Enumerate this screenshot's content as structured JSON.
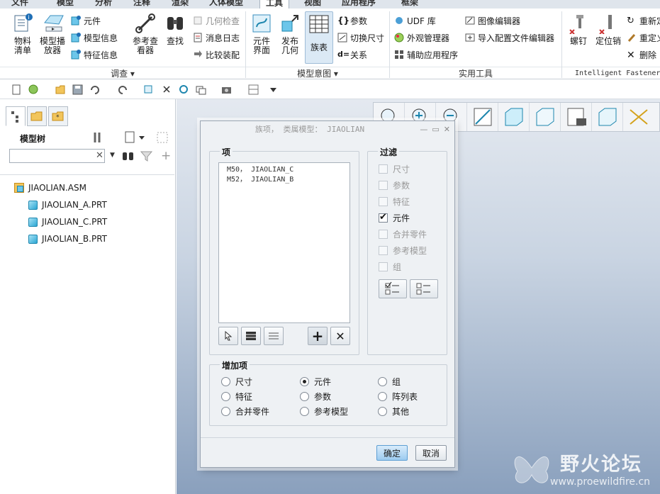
{
  "ribbon_tabs": [
    "文件",
    "模型",
    "分析",
    "注释",
    "渲染",
    "工具",
    "视图",
    "人体模型",
    "应用程序",
    "框架"
  ],
  "active_tab": "工具",
  "ribbon": {
    "investigate": {
      "label": "调查",
      "bom": "物料\n清单",
      "model_player": "模型播\n放器",
      "component": "元件",
      "model_info": "模型信息",
      "feature_info": "特征信息",
      "ref_viewer": "参考查\n看器",
      "find": "查找",
      "geometry_check": "几何检查",
      "message_log": "消息日志",
      "compare_asm": "比较装配"
    },
    "model_intent": {
      "label": "模型意图",
      "component_interface": "元件\n界面",
      "publish_geom": "发布\n几何",
      "family_table": "族表",
      "parameters": "参数",
      "switch_dims": "切换尺寸",
      "relations": "关系"
    },
    "utilities": {
      "label": "实用工具",
      "udf_lib": "UDF 库",
      "appearance_mgr": "外观管理器",
      "aux_apps": "辅助应用程序",
      "image_editor": "图像编辑器",
      "import_config": "导入配置文件编辑器"
    },
    "fastener": {
      "label": "Intelligent Fastener",
      "screw": "螺钉",
      "locating_pin": "定位销",
      "redefine": "重新定",
      "reuse": "重定义",
      "delete": "删除"
    }
  },
  "model_tree": {
    "title": "模型树",
    "search_placeholder": "",
    "root": "JIAOLIAN.ASM",
    "children": [
      "JIAOLIAN_A.PRT",
      "JIAOLIAN_C.PRT",
      "JIAOLIAN_B.PRT"
    ]
  },
  "dialog": {
    "title": "族项，  类属模型：  JIAOLIAN",
    "items_label": "项",
    "items": [
      "M50， JIAOLIAN_C",
      "M52， JIAOLIAN_B"
    ],
    "filter_label": "过滤",
    "filters": [
      {
        "label": "尺寸",
        "checked": false,
        "enabled": false
      },
      {
        "label": "参数",
        "checked": false,
        "enabled": false
      },
      {
        "label": "特征",
        "checked": false,
        "enabled": false
      },
      {
        "label": "元件",
        "checked": true,
        "enabled": true
      },
      {
        "label": "合并零件",
        "checked": false,
        "enabled": false
      },
      {
        "label": "参考模型",
        "checked": false,
        "enabled": false
      },
      {
        "label": "组",
        "checked": false,
        "enabled": false
      }
    ],
    "add_items_label": "增加项",
    "add_options": [
      "尺寸",
      "元件",
      "组",
      "特征",
      "参数",
      "阵列表",
      "合并零件",
      "参考模型",
      "其他"
    ],
    "selected_option": "元件",
    "ok": "确定",
    "cancel": "取消"
  },
  "watermark": {
    "title": "野火论坛",
    "url": "www.proewildfire.cn"
  }
}
